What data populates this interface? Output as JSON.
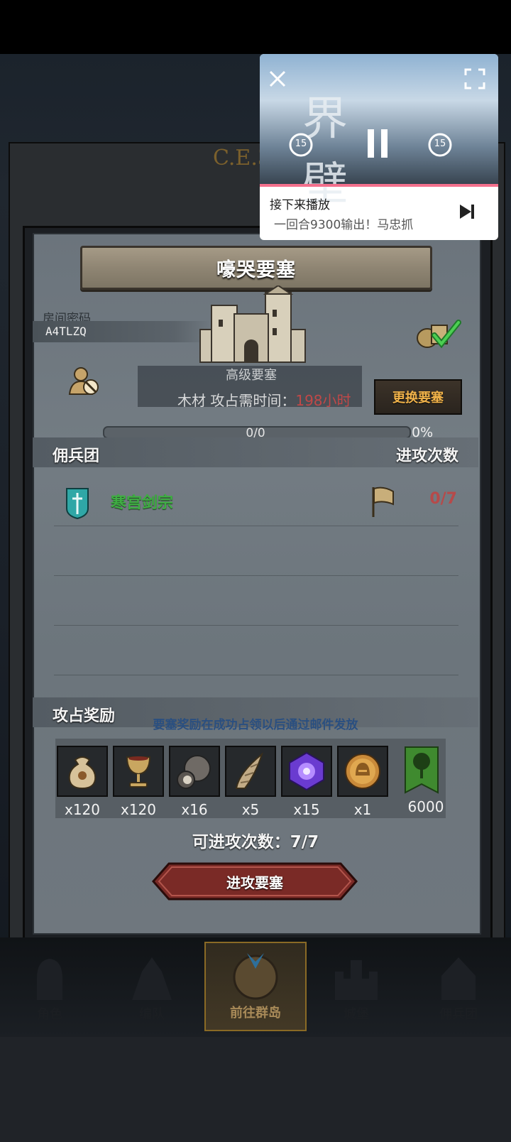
{
  "background": {
    "era_text": "C.E.3"
  },
  "panel": {
    "title": "嚎哭要塞",
    "room_label": "房间密码",
    "room_code": "A4TLZQ",
    "fortress_level": "高级要塞",
    "resource_label": "木材",
    "occupy_label": "攻占需时间：",
    "occupy_hours": "198小时",
    "change_button": "更换要塞",
    "progress_text": "0/0",
    "progress_pct": "0%",
    "progress_value": 0
  },
  "mercenary_section": {
    "left_label": "佣兵团",
    "right_label": "进攻次数",
    "rows": [
      {
        "name": "寒宫剑宗",
        "count": "0/7"
      }
    ]
  },
  "reward_section": {
    "label": "攻占奖励",
    "note": "要塞奖励在成功占领以后通过邮件发放",
    "items": [
      {
        "icon": "sack-icon",
        "qty": "x120"
      },
      {
        "icon": "goblet-icon",
        "qty": "x120"
      },
      {
        "icon": "truffle-icon",
        "qty": "x16"
      },
      {
        "icon": "horn-icon",
        "qty": "x5"
      },
      {
        "icon": "purple-gem-icon",
        "qty": "x15"
      },
      {
        "icon": "helmet-medal-icon",
        "qty": "x1"
      },
      {
        "icon": "tree-banner-icon",
        "qty": "6000"
      }
    ]
  },
  "attack": {
    "count_text": "可进攻次数：7/7",
    "button": "进攻要塞"
  },
  "navbar": [
    {
      "label": "角色",
      "icon": "knight-icon"
    },
    {
      "label": "编队",
      "icon": "formation-icon"
    },
    {
      "label": "前往群岛",
      "icon": "compass-icon"
    },
    {
      "label": "城堡",
      "icon": "castle-icon"
    },
    {
      "label": "佣兵团",
      "icon": "mercenary-icon"
    }
  ],
  "video": {
    "overlay_text": "界 壁",
    "skip_seconds": "15",
    "next_label": "接下来播放",
    "next_title": "一回合9300输出！马忠抓"
  },
  "colors": {
    "accent_gold": "#f0b24a",
    "merc_green": "#3fae43",
    "count_red": "#b64a4a",
    "video_progress": "#f4708d"
  }
}
